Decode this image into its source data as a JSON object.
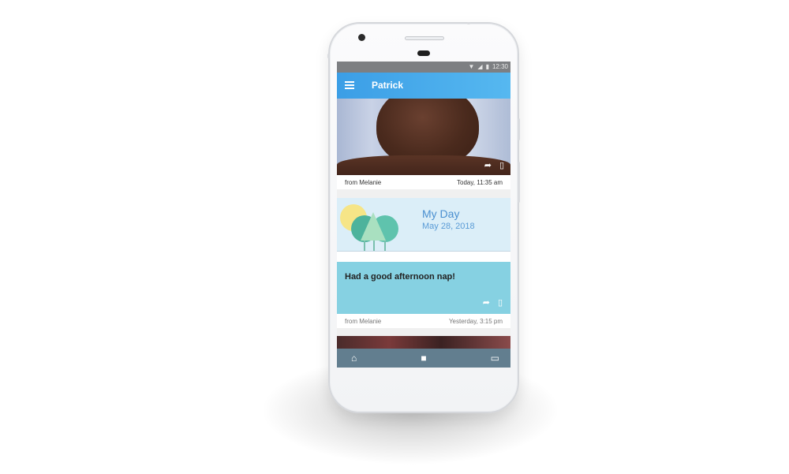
{
  "statusbar": {
    "time": "12:30",
    "icons": [
      "wifi-icon",
      "signal-icon",
      "battery-icon"
    ]
  },
  "appbar": {
    "title": "Patrick",
    "menu_icon": "menu-icon"
  },
  "feed": {
    "photo_post": {
      "from": "from Melanie",
      "time": "Today, 11:35 am",
      "actions": [
        "share-icon",
        "bookmark-icon"
      ]
    },
    "myday": {
      "title": "My Day",
      "date": "May 28, 2018"
    },
    "note_post": {
      "text": "Had a good afternoon nap!",
      "from": "from Melanie",
      "time": "Yesterday, 3:15 pm",
      "actions": [
        "share-icon",
        "bookmark-icon"
      ]
    }
  },
  "bottom_nav": {
    "items": [
      "home-icon",
      "video-icon",
      "chat-icon"
    ]
  },
  "colors": {
    "accent": "#3b9ee6",
    "note_bg": "#86d1e2",
    "myday_bg": "#dbeef8",
    "nav_bg": "#627e8f"
  }
}
